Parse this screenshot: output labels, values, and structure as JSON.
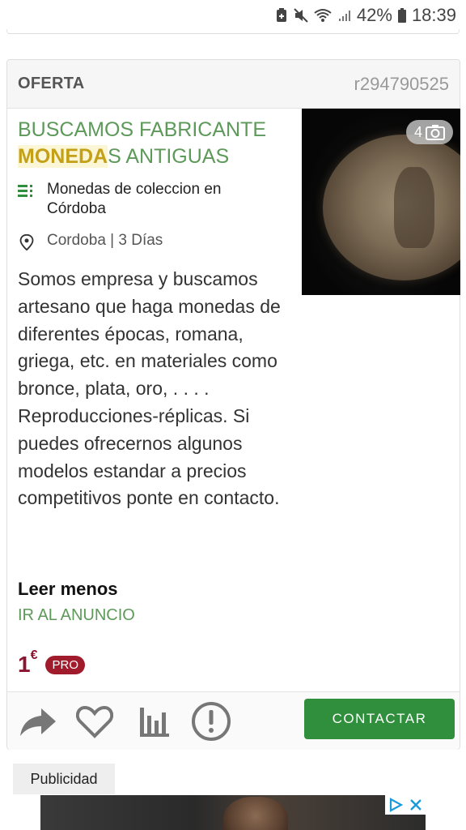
{
  "status_bar": {
    "battery_percent": "42%",
    "time": "18:39"
  },
  "listing": {
    "offer_type": "OFERTA",
    "reference": "r294790525",
    "title_highlight": "MONEDA",
    "title_part1": "BUSCAMOS FABRICANTE",
    "title_part3": "S ANTIGUAS",
    "photo_count": "4",
    "category": "Monedas de coleccion en Córdoba",
    "location": "Cordoba | 3 Días",
    "description": "Somos empresa y buscamos artesano que haga monedas de diferentes épocas, romana, griega, etc. en materiales como bronce, plata, oro, . . . . Reproducciones-réplicas. Si puedes ofrecernos algunos modelos estandar a precios competitivos ponte en contacto.",
    "read_less": "Leer menos",
    "go_to_ad": "IR AL ANUNCIO",
    "price": "1",
    "currency": "€",
    "pro_badge": "PRO",
    "contact_button": "CONTACTAR"
  },
  "ad": {
    "label": "Publicidad"
  },
  "colors": {
    "green_title": "#5d9a5a",
    "highlight_text": "#c4a018",
    "price": "#8a1533",
    "contact_button": "#2f8f3c"
  },
  "icons": [
    "share-icon",
    "heart-icon",
    "stats-icon",
    "report-icon",
    "camera-icon",
    "category-list-icon",
    "location-pin-icon"
  ]
}
